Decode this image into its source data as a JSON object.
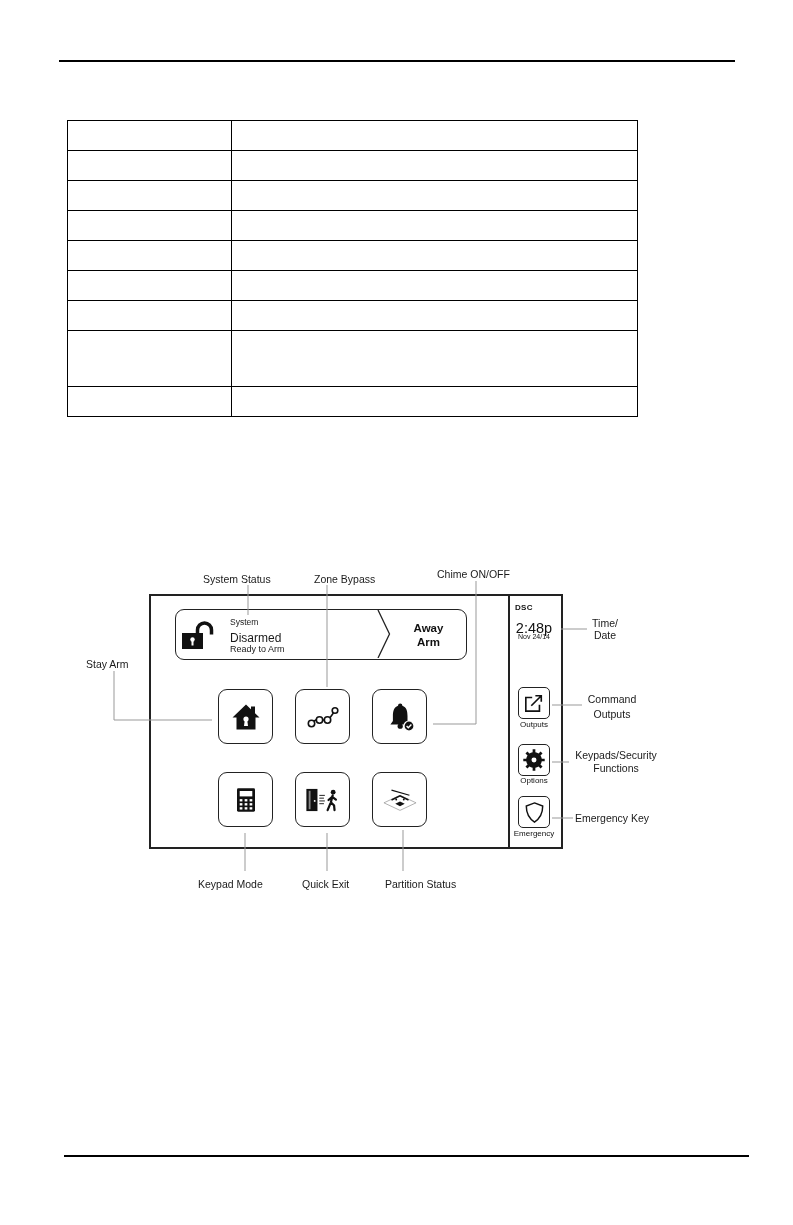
{
  "table": {
    "rows": [
      {
        "kind": "single"
      },
      {
        "kind": "single"
      },
      {
        "kind": "single"
      },
      {
        "kind": "single"
      },
      {
        "kind": "single"
      },
      {
        "kind": "single"
      },
      {
        "kind": "single"
      },
      {
        "kind": "double"
      },
      {
        "kind": "single"
      }
    ]
  },
  "figure": {
    "screen": {
      "status": {
        "title": "System",
        "state": "Disarmed",
        "detail": "Ready to Arm",
        "action": "Away Arm"
      },
      "buttons": [
        {
          "kind": "home"
        },
        {
          "kind": "bypass"
        },
        {
          "kind": "chime"
        },
        {
          "kind": "keypad"
        },
        {
          "kind": "exit"
        },
        {
          "kind": "partition"
        }
      ],
      "side_panel": {
        "logo": "DSC",
        "time": "2:48p",
        "date": "Nov 24/14",
        "buttons": [
          {
            "kind": "outputs",
            "label": "Outputs"
          },
          {
            "kind": "options",
            "label": "Options"
          },
          {
            "kind": "emergency",
            "label": "Emergency"
          }
        ]
      }
    },
    "callouts": [
      "System Status",
      "Zone Bypass",
      "Chime ON/OFF",
      "Stay Arm",
      "Time/ Date",
      "Command Outputs",
      "Keypads/Security Functions",
      "Emergency Key",
      "Keypad Mode",
      "Quick Exit",
      "Partition Status"
    ]
  }
}
